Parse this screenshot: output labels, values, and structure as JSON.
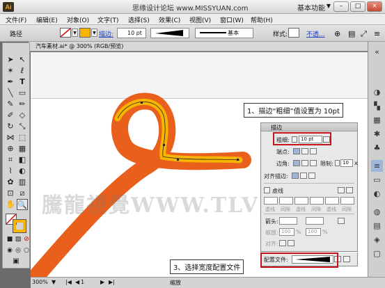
{
  "titlebar": {
    "logo": "Ai",
    "title": "思缘设计论坛 www.MISSYUAN.com",
    "workspace": "基本功能",
    "buttons": [
      "–",
      "□",
      "×"
    ]
  },
  "menu": [
    "文件(F)",
    "编辑(E)",
    "对象(O)",
    "文字(T)",
    "选择(S)",
    "效果(C)",
    "视图(V)",
    "窗口(W)",
    "帮助(H)"
  ],
  "control": {
    "object_type": "路径",
    "stroke_label": "描边:",
    "stroke_weight": "10 pt",
    "profile_label": "基本",
    "style_label": "样式:",
    "opacity_link": "不透..."
  },
  "document_tab": "汽车素材.ai* @ 300% (RGB/预览)",
  "stroke_panel": {
    "title": "描边",
    "weight_label": "粗细:",
    "weight_value": "10 pt",
    "cap_label": "端点:",
    "corner_label": "边角:",
    "limit_label": "限制:",
    "limit_value": "10",
    "limit_unit": "x",
    "align_label": "对齐描边:",
    "dashed_label": "虚线",
    "dash_fields": [
      "虚线",
      "间隙",
      "虚线",
      "间隙",
      "虚线",
      "间隙"
    ],
    "arrow_label": "箭头:",
    "scale_label": "缩放:",
    "scale1": "100",
    "scale2": "100",
    "pct": "%",
    "align_arrow_label": "对齐:",
    "profile_label": "配置文件:"
  },
  "callouts": {
    "step1": "1、描边“粗细”值设置为 10pt",
    "step3": "3、选择宽度配置文件"
  },
  "watermark": "騰龍視覺WWW.TLVNET",
  "status": {
    "zoom": "300%",
    "page": "1",
    "mode": "缩放"
  },
  "colors": {
    "stroke_outer": "#e8601c",
    "stroke_inner": "#f7b400",
    "highlight": "#c4141c"
  }
}
